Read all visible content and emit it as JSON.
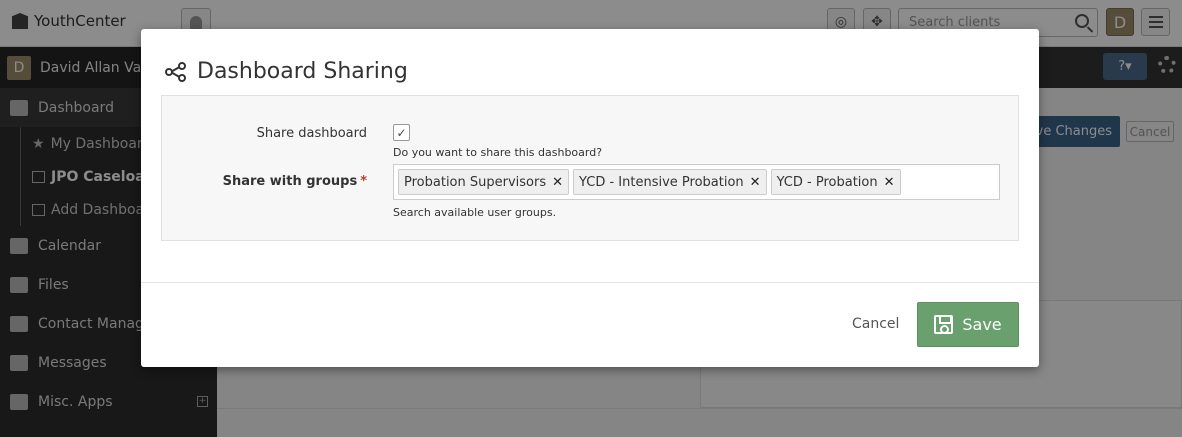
{
  "app": {
    "brand": "YouthCenter",
    "search_placeholder": "Search clients",
    "avatar_letter": "D",
    "user_name": "David Allan Vall",
    "help_label": "?▾"
  },
  "sidebar": {
    "items": [
      {
        "label": "Dashboard",
        "icon": "home-icon"
      },
      {
        "label": "Calendar",
        "icon": "calendar-icon"
      },
      {
        "label": "Files",
        "icon": "folder-icon"
      },
      {
        "label": "Contact Manage",
        "icon": "contact-icon"
      },
      {
        "label": "Messages",
        "icon": "messages-icon"
      },
      {
        "label": "Misc. Apps",
        "icon": "apps-icon"
      }
    ],
    "sub_items": [
      {
        "label": "My Dashboar",
        "icon": "star-icon"
      },
      {
        "label": "JPO Caseload",
        "icon": "window-icon"
      },
      {
        "label": "Add Dashboa",
        "icon": "plus-square-icon"
      }
    ]
  },
  "background": {
    "save_changes": "ve Changes",
    "cancel": "Cancel"
  },
  "modal": {
    "title": "Dashboard Sharing",
    "share_label": "Share dashboard",
    "share_checked": true,
    "share_help": "Do you want to share this dashboard?",
    "groups_label": "Share with groups",
    "required_mark": "*",
    "groups": [
      "Probation Supervisors",
      "YCD - Intensive Probation",
      "YCD - Probation"
    ],
    "groups_help": "Search available user groups.",
    "cancel_label": "Cancel",
    "save_label": "Save",
    "save_color": "#6aa06e"
  }
}
